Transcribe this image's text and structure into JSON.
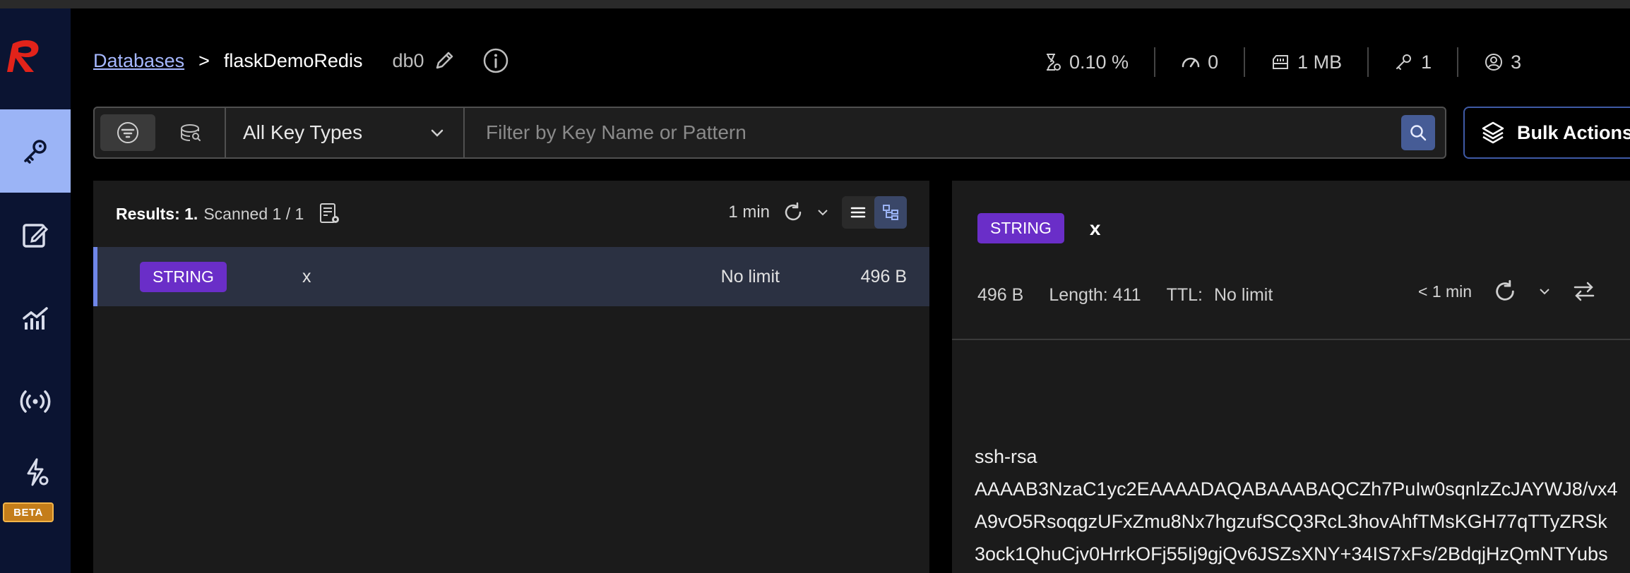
{
  "breadcrumb": {
    "databases": "Databases",
    "separator": ">",
    "database_name": "flaskDemoRedis",
    "db_index": "db0"
  },
  "stats": [
    {
      "icon": "cpu-timer-icon",
      "value": "0.10 %"
    },
    {
      "icon": "gauge-icon",
      "value": "0"
    },
    {
      "icon": "memory-icon",
      "value": "1 MB"
    },
    {
      "icon": "key-icon",
      "value": "1"
    },
    {
      "icon": "user-icon",
      "value": "3"
    }
  ],
  "sidebar": {
    "beta_label": "BETA"
  },
  "filter": {
    "key_type": "All Key Types",
    "placeholder": "Filter by Key Name or Pattern"
  },
  "bulk_actions_label": "Bulk Actions",
  "list": {
    "results_label": "Results: 1.",
    "scanned": "Scanned 1 / 1",
    "refresh_interval": "1 min",
    "rows": [
      {
        "type": "STRING",
        "name": "x",
        "ttl": "No limit",
        "size": "496 B"
      }
    ]
  },
  "detail": {
    "type": "STRING",
    "name": "x",
    "size": "496 B",
    "length": "Length: 411",
    "ttl_label": "TTL:",
    "ttl_value": "No limit",
    "refresh": "< 1 min",
    "value_lines": [
      "ssh-rsa",
      "AAAAB3NzaC1yc2EAAAADAQABAAABAQCZh7PuIw0sqnlzZcJAYWJ8/vx4",
      "A9vO5RsoqgzUFxZmu8Nx7hgzufSCQ3RcL3hovAhfTMsKGH77qTTyZRSk",
      "3ock1QhuCjv0HrrkOFj55Ij9gjQv6JSZsXNY+34IS7xFs/2BdqjHzQmNTYubs"
    ]
  },
  "colors": {
    "sidebar_bg": "#0b1432",
    "active_nav": "#9bb4f6",
    "badge_string": "#6a2ec8",
    "link": "#a6b8ff",
    "logo_red": "#e2231a"
  }
}
